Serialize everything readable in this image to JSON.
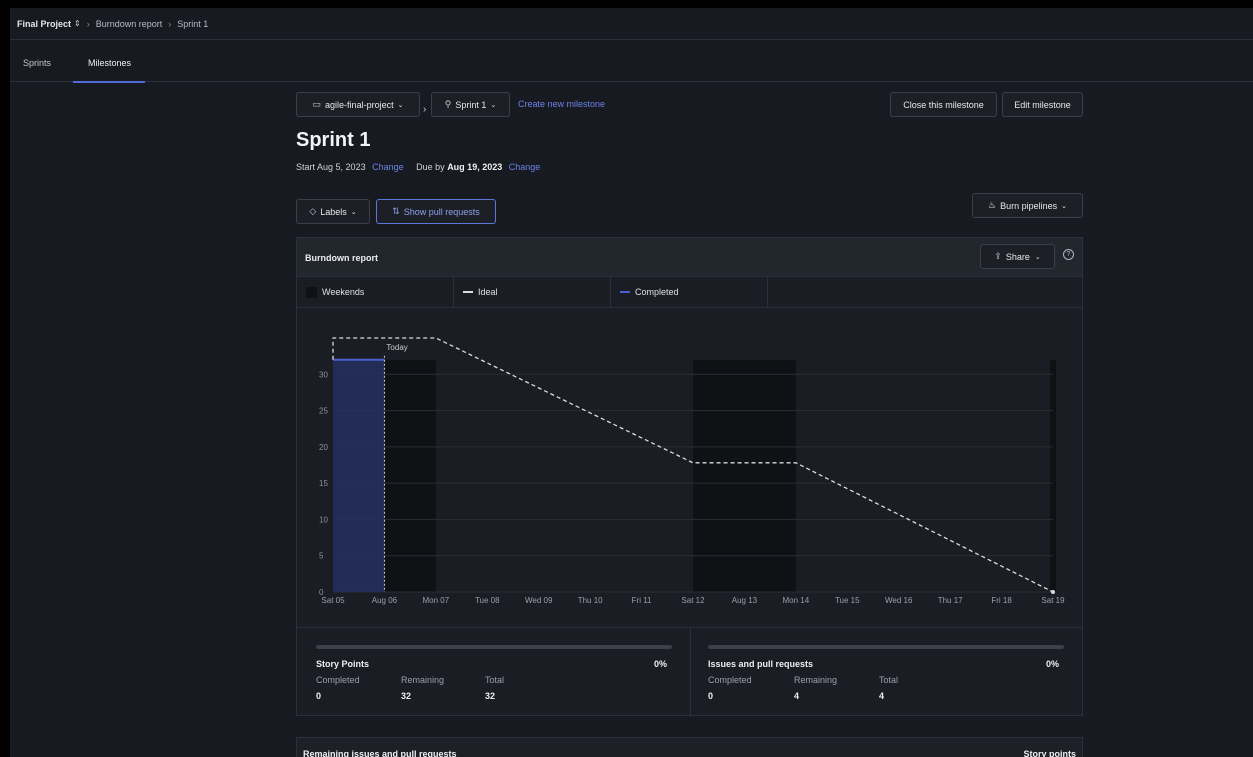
{
  "breadcrumb": {
    "project": "Final Project",
    "project_icon": "⇕",
    "items": [
      "Burndown report",
      "Sprint 1"
    ]
  },
  "tabs": [
    {
      "label": "Sprints",
      "active": false
    },
    {
      "label": "Milestones",
      "active": true
    }
  ],
  "toolbar": {
    "repo_select": "agile-final-project",
    "sprint_select": "Sprint 1",
    "create_milestone": "Create new milestone",
    "close_milestone": "Close this milestone",
    "edit_milestone": "Edit milestone"
  },
  "milestone": {
    "title": "Sprint 1",
    "start_prefix": "Start",
    "start_date": "Aug 5, 2023",
    "change_label": "Change",
    "due_prefix": "Due by",
    "due_date": "Aug 19, 2023"
  },
  "filters": {
    "labels": "Labels",
    "show_prs": "Show pull requests",
    "burn_pipelines": "Burn pipelines"
  },
  "report": {
    "title": "Burndown report",
    "share": "Share",
    "legend": [
      "Weekends",
      "Ideal",
      "Completed"
    ],
    "today_label": "Today"
  },
  "chart_data": {
    "type": "line",
    "title": "Burndown report",
    "xlabel": "",
    "ylabel": "",
    "ylim": [
      0,
      35
    ],
    "yticks": [
      0,
      5,
      10,
      15,
      20,
      25,
      30
    ],
    "categories": [
      "Sat 05",
      "Aug 06",
      "Mon 07",
      "Tue 08",
      "Wed 09",
      "Thu 10",
      "Fri 11",
      "Sat 12",
      "Aug 13",
      "Mon 14",
      "Tue 15",
      "Wed 16",
      "Thu 17",
      "Fri 18",
      "Sat 19"
    ],
    "weekends": [
      [
        "Sat 05",
        "Mon 07"
      ],
      [
        "Sat 12",
        "Mon 14"
      ],
      [
        "Sat 19",
        "Sat 19"
      ]
    ],
    "today": "Aug 06",
    "series": [
      {
        "name": "Ideal",
        "style": "dashed",
        "color": "#d9dce1",
        "points": [
          [
            "Sat 05",
            32
          ],
          [
            "Mon 07",
            32
          ],
          [
            "Sat 12",
            17.8
          ],
          [
            "Mon 14",
            17.8
          ],
          [
            "Sat 19",
            0
          ]
        ]
      },
      {
        "name": "Completed",
        "style": "solid",
        "color": "#4a60d0",
        "points": [
          [
            "Sat 05",
            32
          ],
          [
            "Aug 06",
            32
          ]
        ]
      }
    ],
    "grid": true,
    "legend_position": "top"
  },
  "stats": {
    "story_points": {
      "title": "Story Points",
      "percent": "0%",
      "completed_label": "Completed",
      "remaining_label": "Remaining",
      "total_label": "Total",
      "completed": "0",
      "remaining": "32",
      "total": "32",
      "progress": 0
    },
    "issues": {
      "title": "Issues and pull requests",
      "percent": "0%",
      "completed_label": "Completed",
      "remaining_label": "Remaining",
      "total_label": "Total",
      "completed": "0",
      "remaining": "4",
      "total": "4",
      "progress": 0
    }
  },
  "remaining_section": {
    "title": "Remaining issues and pull requests",
    "column": "Story points"
  },
  "colors": {
    "accent": "#4f6bd6",
    "link": "#6b83e8",
    "completed_fill": "#26305e",
    "weekend": "#0f1115"
  }
}
